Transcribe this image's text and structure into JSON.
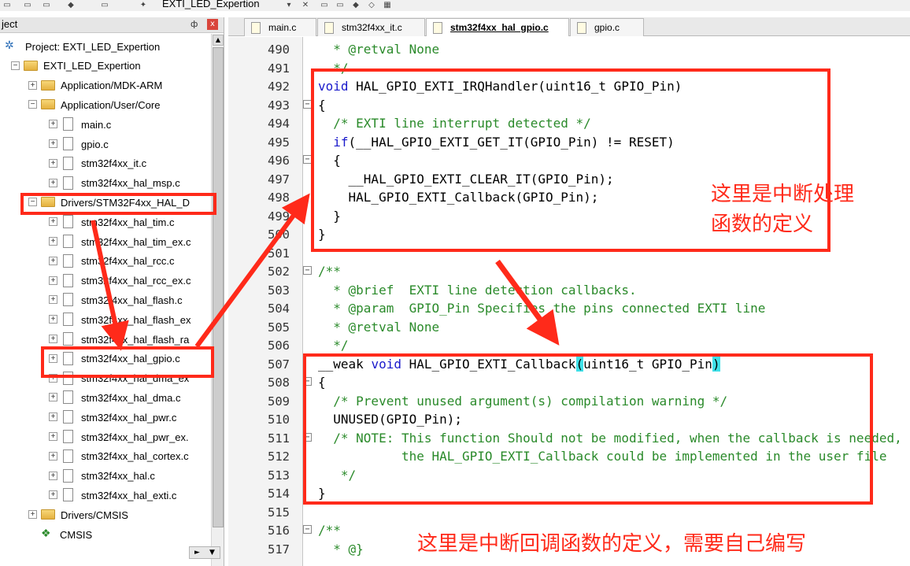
{
  "toolbar": {
    "target_name": "EXTI_LED_Expertion"
  },
  "project_panel": {
    "title": "ject",
    "pin": "ф",
    "close": "x",
    "items": [
      {
        "label": "Project: EXTI_LED_Expertion",
        "icon": "project-icon"
      },
      {
        "label": "EXTI_LED_Expertion",
        "icon": "target-icon"
      },
      {
        "label": "Application/MDK-ARM",
        "icon": "folder-icon"
      },
      {
        "label": "Application/User/Core",
        "icon": "folder-icon"
      },
      {
        "label": "main.c",
        "icon": "file-icon"
      },
      {
        "label": "gpio.c",
        "icon": "file-icon"
      },
      {
        "label": "stm32f4xx_it.c",
        "icon": "file-icon"
      },
      {
        "label": "stm32f4xx_hal_msp.c",
        "icon": "file-icon"
      },
      {
        "label": "Drivers/STM32F4xx_HAL_D",
        "icon": "folder-icon"
      },
      {
        "label": "stm32f4xx_hal_tim.c",
        "icon": "file-icon"
      },
      {
        "label": "stm32f4xx_hal_tim_ex.c",
        "icon": "file-icon"
      },
      {
        "label": "stm32f4xx_hal_rcc.c",
        "icon": "file-icon"
      },
      {
        "label": "stm32f4xx_hal_rcc_ex.c",
        "icon": "file-icon"
      },
      {
        "label": "stm32f4xx_hal_flash.c",
        "icon": "file-icon"
      },
      {
        "label": "stm32f4xx_hal_flash_ex",
        "icon": "file-icon"
      },
      {
        "label": "stm32f4xx_hal_flash_ra",
        "icon": "file-icon"
      },
      {
        "label": "stm32f4xx_hal_gpio.c",
        "icon": "file-icon"
      },
      {
        "label": "stm32f4xx_hal_dma_ex",
        "icon": "file-icon"
      },
      {
        "label": "stm32f4xx_hal_dma.c",
        "icon": "file-icon"
      },
      {
        "label": "stm32f4xx_hal_pwr.c",
        "icon": "file-icon"
      },
      {
        "label": "stm32f4xx_hal_pwr_ex.",
        "icon": "file-icon"
      },
      {
        "label": "stm32f4xx_hal_cortex.c",
        "icon": "file-icon"
      },
      {
        "label": "stm32f4xx_hal.c",
        "icon": "file-icon"
      },
      {
        "label": "stm32f4xx_hal_exti.c",
        "icon": "file-icon"
      },
      {
        "label": "Drivers/CMSIS",
        "icon": "folder-icon"
      },
      {
        "label": "CMSIS",
        "icon": "cmsis-icon"
      }
    ]
  },
  "tabs": [
    {
      "label": "main.c",
      "active": false
    },
    {
      "label": "stm32f4xx_it.c",
      "active": false
    },
    {
      "label": "stm32f4xx_hal_gpio.c",
      "active": true
    },
    {
      "label": "gpio.c",
      "active": false
    }
  ],
  "code_lines": [
    {
      "n": "490",
      "parts": [
        [
          "cm",
          "  * @retval None"
        ]
      ]
    },
    {
      "n": "491",
      "parts": [
        [
          "cm",
          "  */"
        ]
      ]
    },
    {
      "n": "492",
      "parts": [
        [
          "kw",
          "void"
        ],
        [
          "",
          " HAL_GPIO_EXTI_IRQHandler(uint16_t GPIO_Pin)"
        ]
      ]
    },
    {
      "n": "493",
      "parts": [
        [
          "",
          "{"
        ]
      ]
    },
    {
      "n": "494",
      "parts": [
        [
          "cm",
          "  /* EXTI line interrupt detected */"
        ]
      ]
    },
    {
      "n": "495",
      "parts": [
        [
          "",
          "  "
        ],
        [
          "kw",
          "if"
        ],
        [
          "",
          "(__HAL_GPIO_EXTI_GET_IT(GPIO_Pin) != RESET)"
        ]
      ]
    },
    {
      "n": "496",
      "parts": [
        [
          "",
          "  {"
        ]
      ]
    },
    {
      "n": "497",
      "parts": [
        [
          "",
          "    __HAL_GPIO_EXTI_CLEAR_IT(GPIO_Pin);"
        ]
      ]
    },
    {
      "n": "498",
      "parts": [
        [
          "",
          "    HAL_GPIO_EXTI_Callback(GPIO_Pin);"
        ]
      ]
    },
    {
      "n": "499",
      "parts": [
        [
          "",
          "  }"
        ]
      ]
    },
    {
      "n": "500",
      "parts": [
        [
          "",
          "}"
        ]
      ]
    },
    {
      "n": "501",
      "parts": [
        [
          "",
          ""
        ]
      ]
    },
    {
      "n": "502",
      "parts": [
        [
          "cm",
          "/**"
        ]
      ]
    },
    {
      "n": "503",
      "parts": [
        [
          "cm",
          "  * @brief  EXTI line detection callbacks."
        ]
      ]
    },
    {
      "n": "504",
      "parts": [
        [
          "cm",
          "  * @param  GPIO_Pin Specifies the pins connected EXTI line"
        ]
      ]
    },
    {
      "n": "505",
      "parts": [
        [
          "cm",
          "  * @retval None"
        ]
      ]
    },
    {
      "n": "506",
      "parts": [
        [
          "cm",
          "  */"
        ]
      ]
    },
    {
      "n": "507",
      "parts": [
        [
          "",
          "__weak "
        ],
        [
          "kw",
          "void"
        ],
        [
          "",
          " HAL_GPIO_EXTI_Callback"
        ],
        [
          "hl",
          "("
        ],
        [
          "",
          "uint16_t GPIO_Pin"
        ],
        [
          "hl",
          ")"
        ]
      ]
    },
    {
      "n": "508",
      "parts": [
        [
          "",
          "{"
        ]
      ]
    },
    {
      "n": "509",
      "parts": [
        [
          "cm",
          "  /* Prevent unused argument(s) compilation warning */"
        ]
      ]
    },
    {
      "n": "510",
      "parts": [
        [
          "",
          "  UNUSED(GPIO_Pin);"
        ]
      ]
    },
    {
      "n": "511",
      "parts": [
        [
          "cm",
          "  /* NOTE: This function Should not be modified, when the callback is needed,"
        ]
      ]
    },
    {
      "n": "512",
      "parts": [
        [
          "cm",
          "           the HAL_GPIO_EXTI_Callback could be implemented in the user file"
        ]
      ]
    },
    {
      "n": "513",
      "parts": [
        [
          "cm",
          "   */"
        ]
      ]
    },
    {
      "n": "514",
      "parts": [
        [
          "",
          "}"
        ]
      ]
    },
    {
      "n": "515",
      "parts": [
        [
          "",
          ""
        ]
      ]
    },
    {
      "n": "516",
      "parts": [
        [
          "cm",
          "/**"
        ]
      ]
    },
    {
      "n": "517",
      "parts": [
        [
          "cm",
          "  * @}"
        ]
      ]
    }
  ],
  "annotations": {
    "irq_line1": "这里是中断处理",
    "irq_line2": "函数的定义",
    "callback": "这里是中断回调函数的定义，需要自己编写"
  },
  "accent_color": "#ff2a1a"
}
